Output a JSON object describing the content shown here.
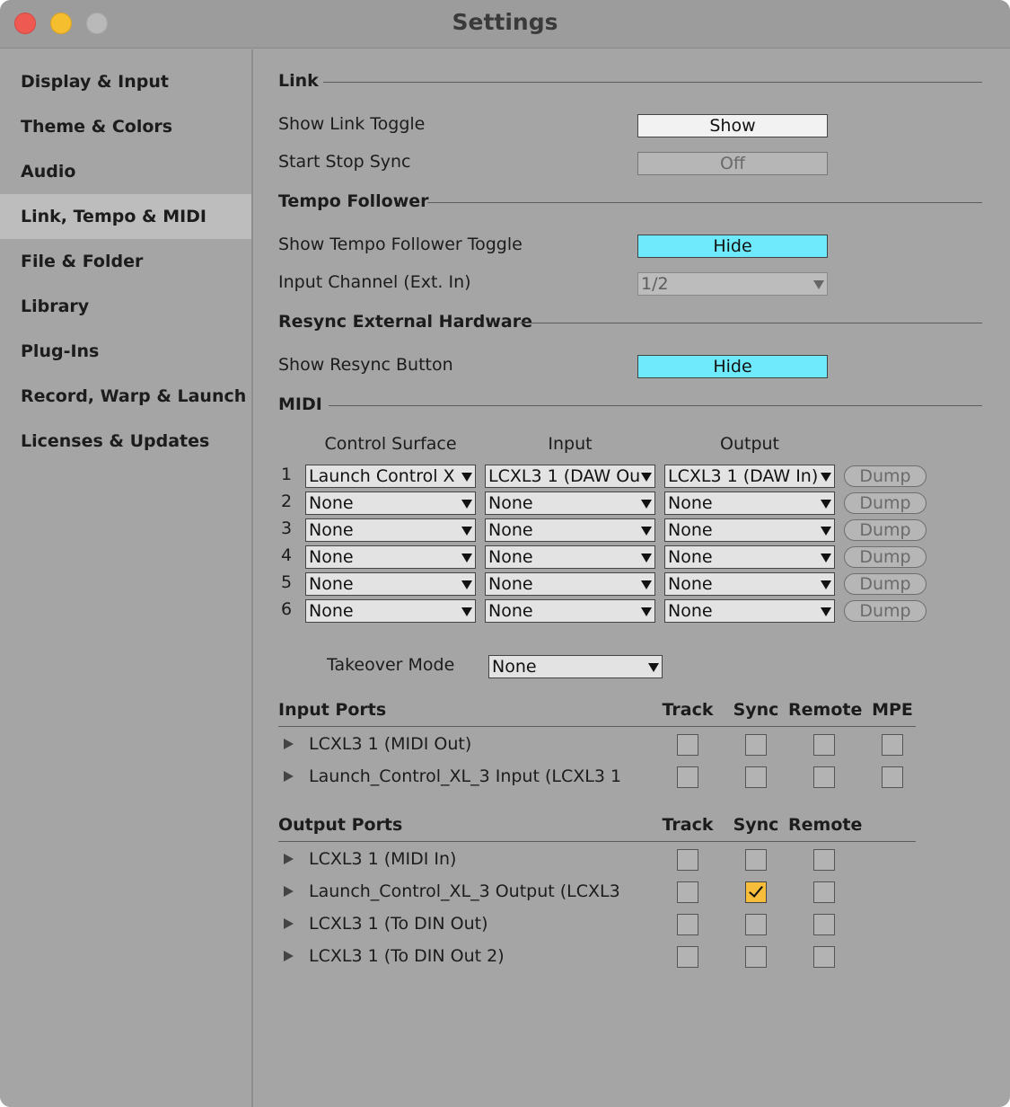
{
  "window": {
    "title": "Settings"
  },
  "sidebar": {
    "items": [
      {
        "label": "Display & Input"
      },
      {
        "label": "Theme & Colors"
      },
      {
        "label": "Audio"
      },
      {
        "label": "Link, Tempo & MIDI",
        "active": true
      },
      {
        "label": "File & Folder"
      },
      {
        "label": "Library"
      },
      {
        "label": "Plug-Ins"
      },
      {
        "label": "Record, Warp & Launch"
      },
      {
        "label": "Licenses & Updates"
      }
    ]
  },
  "link": {
    "heading": "Link",
    "show_link_toggle": {
      "label": "Show Link Toggle",
      "value": "Show"
    },
    "start_stop_sync": {
      "label": "Start Stop Sync",
      "value": "Off"
    }
  },
  "tempo_follower": {
    "heading": "Tempo Follower",
    "show_toggle": {
      "label": "Show Tempo Follower Toggle",
      "value": "Hide"
    },
    "input_channel": {
      "label": "Input Channel (Ext. In)",
      "value": "1/2"
    }
  },
  "resync": {
    "heading": "Resync External Hardware",
    "show_button": {
      "label": "Show Resync Button",
      "value": "Hide"
    }
  },
  "midi": {
    "heading": "MIDI",
    "col_control_surface": "Control Surface",
    "col_input": "Input",
    "col_output": "Output",
    "dump_label": "Dump",
    "rows": [
      {
        "num": "1",
        "surface": "Launch Control X",
        "input": "LCXL3 1 (DAW Ou",
        "output": "LCXL3 1 (DAW In)"
      },
      {
        "num": "2",
        "surface": "None",
        "input": "None",
        "output": "None"
      },
      {
        "num": "3",
        "surface": "None",
        "input": "None",
        "output": "None"
      },
      {
        "num": "4",
        "surface": "None",
        "input": "None",
        "output": "None"
      },
      {
        "num": "5",
        "surface": "None",
        "input": "None",
        "output": "None"
      },
      {
        "num": "6",
        "surface": "None",
        "input": "None",
        "output": "None"
      }
    ],
    "takeover": {
      "label": "Takeover Mode",
      "value": "None"
    }
  },
  "input_ports": {
    "heading": "Input Ports",
    "cols": [
      "Track",
      "Sync",
      "Remote",
      "MPE"
    ],
    "rows": [
      {
        "name": "LCXL3 1 (MIDI Out)",
        "checks": [
          false,
          false,
          false,
          false
        ]
      },
      {
        "name": "Launch_Control_XL_3 Input (LCXL3 1",
        "checks": [
          false,
          false,
          false,
          false
        ]
      }
    ]
  },
  "output_ports": {
    "heading": "Output Ports",
    "cols": [
      "Track",
      "Sync",
      "Remote"
    ],
    "rows": [
      {
        "name": "LCXL3 1 (MIDI In)",
        "checks": [
          false,
          false,
          false
        ]
      },
      {
        "name": "Launch_Control_XL_3 Output (LCXL3",
        "checks": [
          false,
          true,
          false
        ]
      },
      {
        "name": "LCXL3 1 (To DIN Out)",
        "checks": [
          false,
          false,
          false
        ]
      },
      {
        "name": "LCXL3 1 (To DIN Out 2)",
        "checks": [
          false,
          false,
          false
        ]
      }
    ]
  },
  "colors": {
    "accent_cyan": "#6eeafc",
    "checkbox_checked": "#f7bd3b",
    "close": "#ee5a52",
    "minimize": "#f5be2f"
  }
}
